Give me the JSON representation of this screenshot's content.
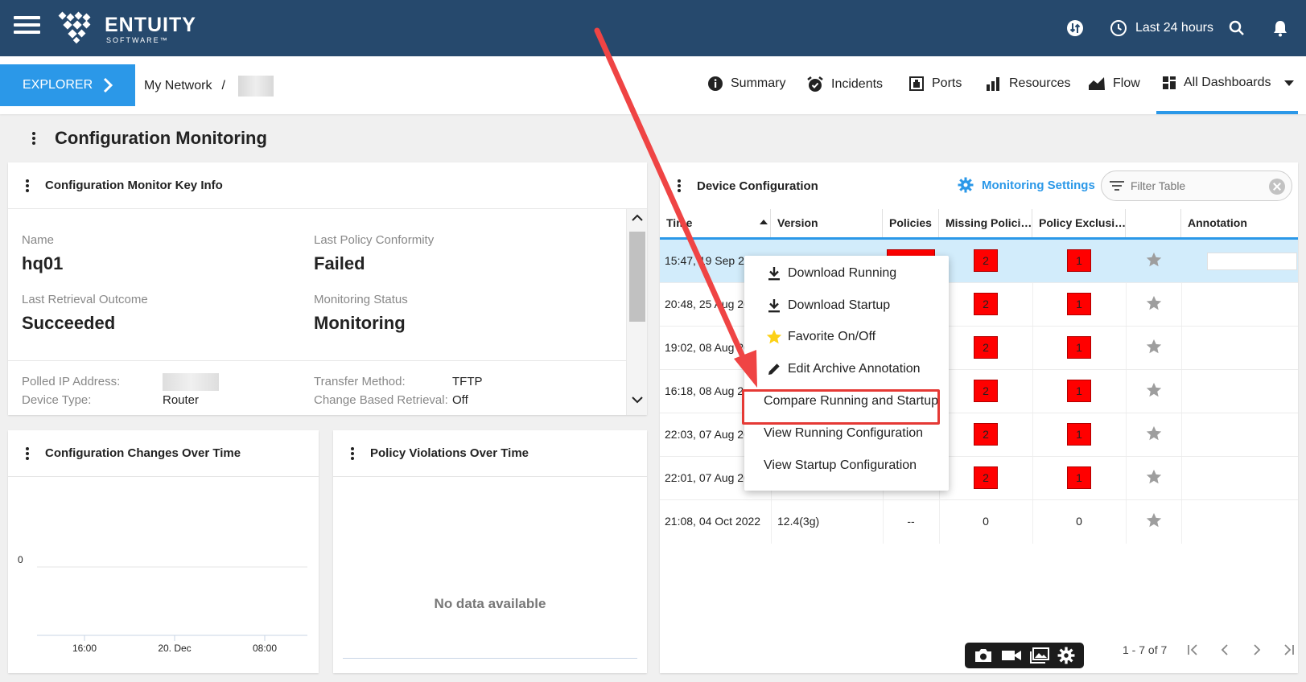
{
  "header": {
    "logo_word": "ENTUITY",
    "logo_sub": "SOFTWARE™",
    "time_range": "Last 24 hours"
  },
  "nav": {
    "explorer_label": "EXPLORER",
    "breadcrumb_root": "My Network",
    "breadcrumb_sep": "/",
    "tabs": [
      {
        "label": "Summary",
        "icon": "info-icon"
      },
      {
        "label": "Incidents",
        "icon": "alarm-icon"
      },
      {
        "label": "Ports",
        "icon": "port-icon"
      },
      {
        "label": "Resources",
        "icon": "bar-chart-icon"
      },
      {
        "label": "Flow",
        "icon": "flow-chart-icon"
      },
      {
        "label": "All Dashboards",
        "icon": "dashboard-grid-icon"
      }
    ]
  },
  "page": {
    "title": "Configuration Monitoring"
  },
  "key_info": {
    "title": "Configuration Monitor Key Info",
    "name_label": "Name",
    "name_value": "hq01",
    "conformity_label": "Last Policy Conformity",
    "conformity_value": "Failed",
    "retrieval_label": "Last Retrieval Outcome",
    "retrieval_value": "Succeeded",
    "status_label": "Monitoring Status",
    "status_value": "Monitoring",
    "polled_ip_label": "Polled IP Address:",
    "device_type_label": "Device Type:",
    "device_type_value": "Router",
    "transfer_label": "Transfer Method:",
    "transfer_value": "TFTP",
    "change_based_label": "Change Based Retrieval:",
    "change_based_value": "Off"
  },
  "changes_chart": {
    "title": "Configuration Changes Over Time",
    "y_tick": "0",
    "x_ticks": [
      "16:00",
      "20. Dec",
      "08:00"
    ]
  },
  "violations_chart": {
    "title": "Policy Violations Over Time",
    "empty_text": "No data available"
  },
  "device_config": {
    "title": "Device Configuration",
    "settings_label": "Monitoring Settings",
    "filter_placeholder": "Filter Table",
    "columns": [
      "Time",
      "Version",
      "Policies",
      "Missing Polici…",
      "Policy Exclusi…",
      "",
      "Annotation"
    ],
    "rows": [
      {
        "time": "15:47, 19 Sep 2022",
        "version": "",
        "policies": "",
        "missing": "2",
        "exclusions": "1"
      },
      {
        "time": "20:48, 25 Aug 2022",
        "version": "",
        "policies": "",
        "missing": "2",
        "exclusions": "1"
      },
      {
        "time": "19:02, 08 Aug 2022",
        "version": "",
        "policies": "",
        "missing": "2",
        "exclusions": "1"
      },
      {
        "time": "16:18, 08 Aug 2022",
        "version": "",
        "policies": "",
        "missing": "2",
        "exclusions": "1"
      },
      {
        "time": "22:03, 07 Aug 2022",
        "version": "",
        "policies": "",
        "missing": "2",
        "exclusions": "1"
      },
      {
        "time": "22:01, 07 Aug 2022",
        "version": "",
        "policies": "",
        "missing": "2",
        "exclusions": "1"
      },
      {
        "time": "21:08, 04 Oct 2022",
        "version": "12.4(3g)",
        "policies": "--",
        "missing": "0",
        "exclusions": "0"
      }
    ],
    "pager_text": "1 - 7 of 7"
  },
  "context_menu": {
    "items": [
      "Download Running",
      "Download Startup",
      "Favorite On/Off",
      "Edit Archive Annotation",
      "Compare Running and Startup",
      "View Running Configuration",
      "View Startup Configuration"
    ]
  },
  "colors": {
    "header_bg": "#26496d",
    "accent": "#2b98e8",
    "violation_red": "#ff0000",
    "annotation_red": "#e53935",
    "selected_row": "#d2ecfb"
  }
}
